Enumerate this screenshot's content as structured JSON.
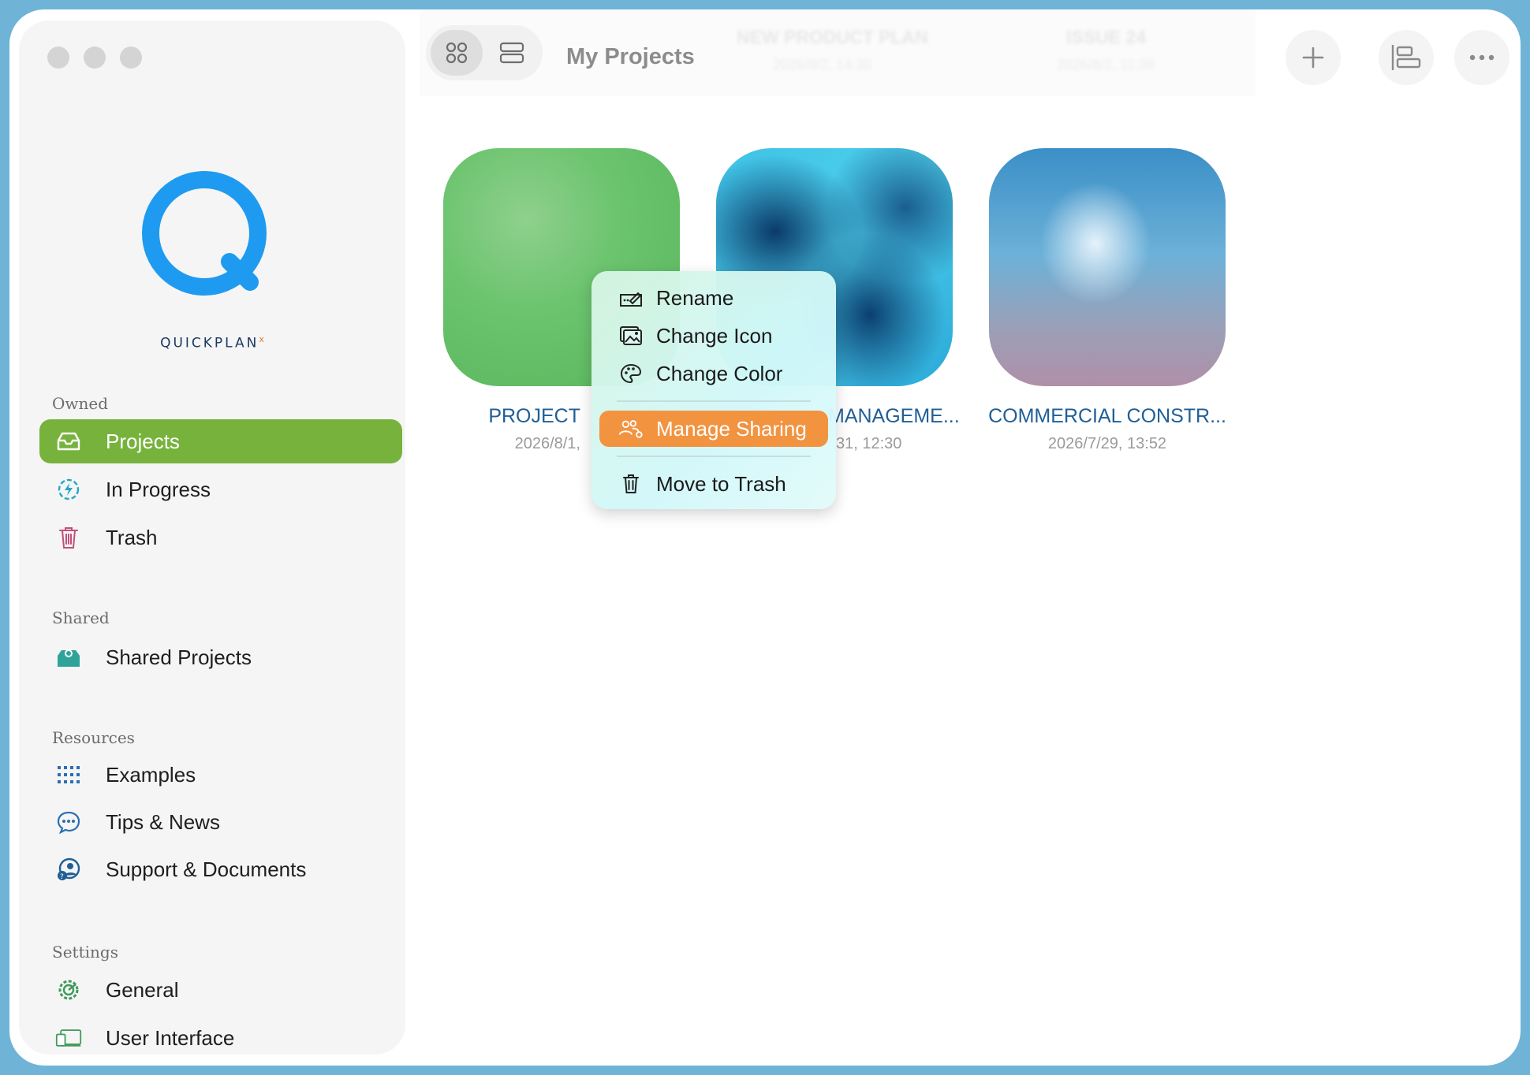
{
  "sidebar": {
    "brand": "QUICKPLAN",
    "brand_mark": "x",
    "sections": {
      "owned": "Owned",
      "shared": "Shared",
      "resources": "Resources",
      "settings": "Settings"
    },
    "items": {
      "projects": "Projects",
      "in_progress": "In Progress",
      "trash": "Trash",
      "shared_projects": "Shared Projects",
      "examples": "Examples",
      "tips_news": "Tips & News",
      "support_docs": "Support & Documents",
      "general": "General",
      "user_interface": "User Interface"
    },
    "active_item": "Projects"
  },
  "toolbar": {
    "title": "My Projects",
    "background_titles": [
      "NEW PRODUCT PLAN",
      "ISSUE 24"
    ],
    "background_dates": [
      "2026/8/2, 14:30",
      "2026/8/2, 11:38"
    ]
  },
  "projects": [
    {
      "title": "PROJECT",
      "date": "2026/8/1,"
    },
    {
      "title": "MANAGEME...",
      "date": "31, 12:30"
    },
    {
      "title": "COMMERCIAL CONSTR...",
      "date": "2026/7/29, 13:52"
    }
  ],
  "context_menu": {
    "rename": "Rename",
    "change_icon": "Change Icon",
    "change_color": "Change Color",
    "manage_sharing": "Manage Sharing",
    "move_to_trash": "Move to Trash",
    "highlighted": "Manage Sharing"
  },
  "colors": {
    "accent_green": "#77b33c",
    "highlight_orange": "#f29340",
    "link_blue": "#1f5f96",
    "logo_blue": "#1e9bf0"
  }
}
